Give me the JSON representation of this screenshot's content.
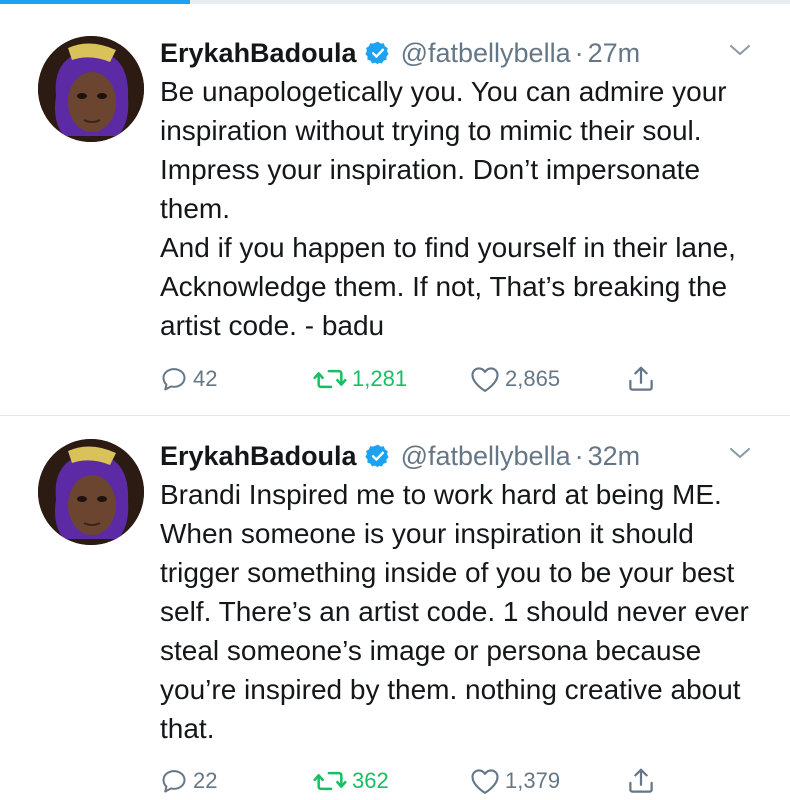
{
  "colors": {
    "accent": "#1da1f2",
    "retweeted": "#17bf63",
    "secondary_text": "#657786",
    "divider": "#e1e8ed"
  },
  "progress": {
    "fraction": 0.24
  },
  "tweets": [
    {
      "name": "ErykahBadoula",
      "handle": "@fatbellybella",
      "separator": "·",
      "time": "27m",
      "text": "Be unapologetically you. You can admire your inspiration without trying to mimic their soul. Impress your inspiration. Don’t impersonate them.\nAnd if you happen to find yourself in their lane, Acknowledge them. If not, That’s breaking the artist code. - badu",
      "replies": "42",
      "retweets": "1,281",
      "likes": "2,865",
      "icons": {
        "reply": "reply-icon",
        "retweet": "retweet-icon",
        "like": "heart-icon",
        "share": "share-icon",
        "menu": "chevron-down-icon",
        "verified": "verified-badge-icon"
      }
    },
    {
      "name": "ErykahBadoula",
      "handle": "@fatbellybella",
      "separator": "·",
      "time": "32m",
      "text": "Brandi Inspired me to work hard at being ME. When someone is your inspiration it should trigger something inside of you to be your best self. There’s an artist code. 1 should never ever steal someone’s image or persona because you’re inspired by them. nothing creative about that.",
      "replies": "22",
      "retweets": "362",
      "likes": "1,379",
      "icons": {
        "reply": "reply-icon",
        "retweet": "retweet-icon",
        "like": "heart-icon",
        "share": "share-icon",
        "menu": "chevron-down-icon",
        "verified": "verified-badge-icon"
      }
    }
  ]
}
